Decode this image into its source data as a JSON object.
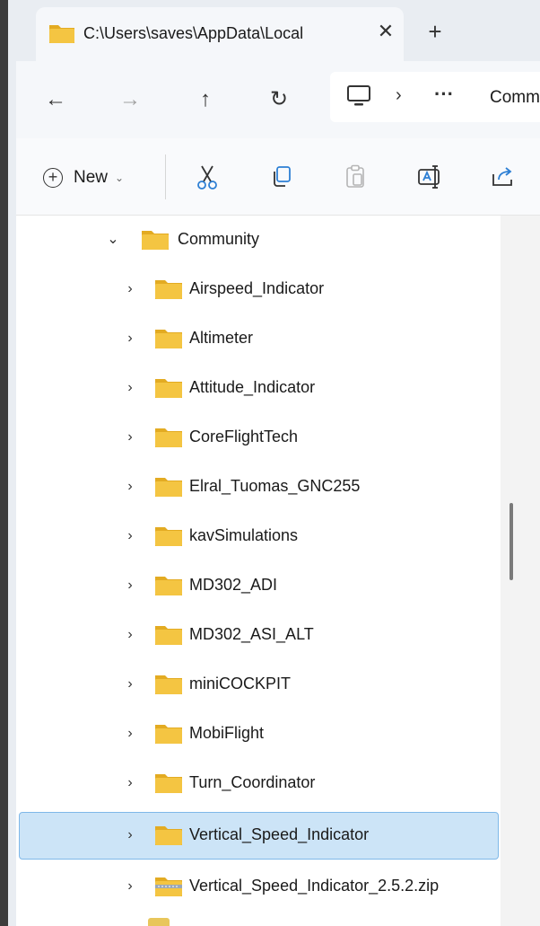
{
  "tab": {
    "title": "C:\\Users\\saves\\AppData\\Local",
    "close_glyph": "✕",
    "new_tab_glyph": "+"
  },
  "nav": {
    "back_glyph": "←",
    "forward_glyph": "→",
    "up_glyph": "↑",
    "refresh_glyph": "↻"
  },
  "address": {
    "chevron_glyph": "›",
    "ellipsis": "···",
    "crumb": "Comm"
  },
  "command_bar": {
    "new_label": "New",
    "new_caret": "⌄",
    "new_plus": "+"
  },
  "tree": {
    "parent": {
      "label": "Community",
      "expanded_glyph": "⌄"
    },
    "collapsed_glyph": "›",
    "items": [
      {
        "label": "Airspeed_Indicator",
        "type": "folder"
      },
      {
        "label": "Altimeter",
        "type": "folder"
      },
      {
        "label": "Attitude_Indicator",
        "type": "folder"
      },
      {
        "label": "CoreFlightTech",
        "type": "folder"
      },
      {
        "label": "Elral_Tuomas_GNC255",
        "type": "folder"
      },
      {
        "label": "kavSimulations",
        "type": "folder"
      },
      {
        "label": "MD302_ADI",
        "type": "folder"
      },
      {
        "label": "MD302_ASI_ALT",
        "type": "folder"
      },
      {
        "label": "miniCOCKPIT",
        "type": "folder"
      },
      {
        "label": "MobiFlight",
        "type": "folder"
      },
      {
        "label": "Turn_Coordinator",
        "type": "folder"
      },
      {
        "label": "Vertical_Speed_Indicator",
        "type": "folder",
        "selected": true
      },
      {
        "label": "Vertical_Speed_Indicator_2.5.2.zip",
        "type": "zip"
      }
    ]
  },
  "colors": {
    "folder": "#f4c542",
    "folder_dark": "#e3ab22",
    "selection_bg": "#cce4f7",
    "selection_border": "#7fb8e8"
  }
}
